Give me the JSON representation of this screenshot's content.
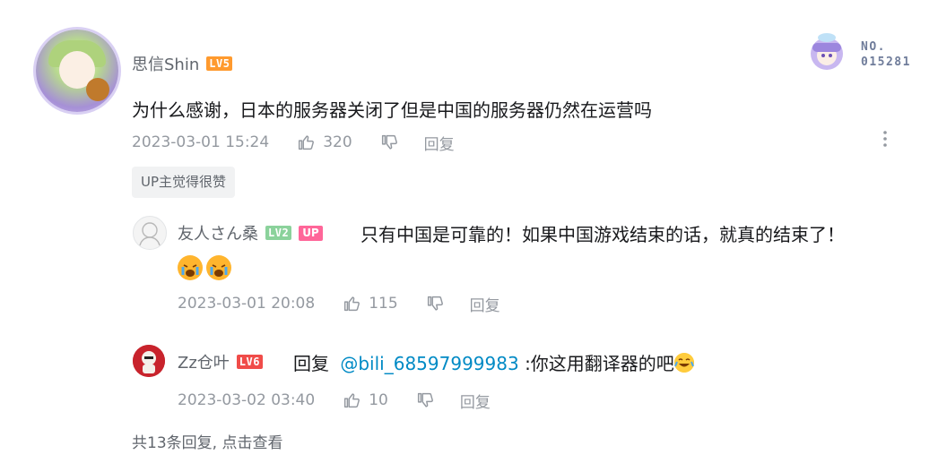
{
  "main_comment": {
    "username": "思信Shin",
    "level": "LV5",
    "content": "为什么感谢，日本的服务器关闭了但是中国的服务器仍然在运营吗",
    "timestamp": "2023-03-01 15:24",
    "likes": "320",
    "reply_label": "回复",
    "up_liked_label": "UP主觉得很赞",
    "fan_badge": {
      "line1": "NO.",
      "line2": "015281"
    }
  },
  "replies": [
    {
      "username": "友人さん桑",
      "level": "LV2",
      "up_tag": "UP",
      "content": "只有中国是可靠的！如果中国游戏结束的话，就真的结束了！",
      "emojis": [
        "crying-emoji",
        "crying-emoji"
      ],
      "timestamp": "2023-03-01 20:08",
      "likes": "115",
      "reply_label": "回复"
    },
    {
      "username": "Zz仓叶",
      "level": "LV6",
      "reply_prefix": "回复",
      "mention": "@bili_68597999983",
      "content": ":你这用翻译器的吧",
      "emoji": "laughing-tears-emoji",
      "timestamp": "2023-03-02 03:40",
      "likes": "10",
      "reply_label": "回复"
    }
  ],
  "more_replies_label": "共13条回复, 点击查看",
  "colors": {
    "text": "#18191c",
    "meta": "#9499a0",
    "link": "#008ac5",
    "up_tag": "#ff6699",
    "lv5": "#ff9a2e",
    "lv6": "#f04c49",
    "lv2": "#8bd29b"
  }
}
